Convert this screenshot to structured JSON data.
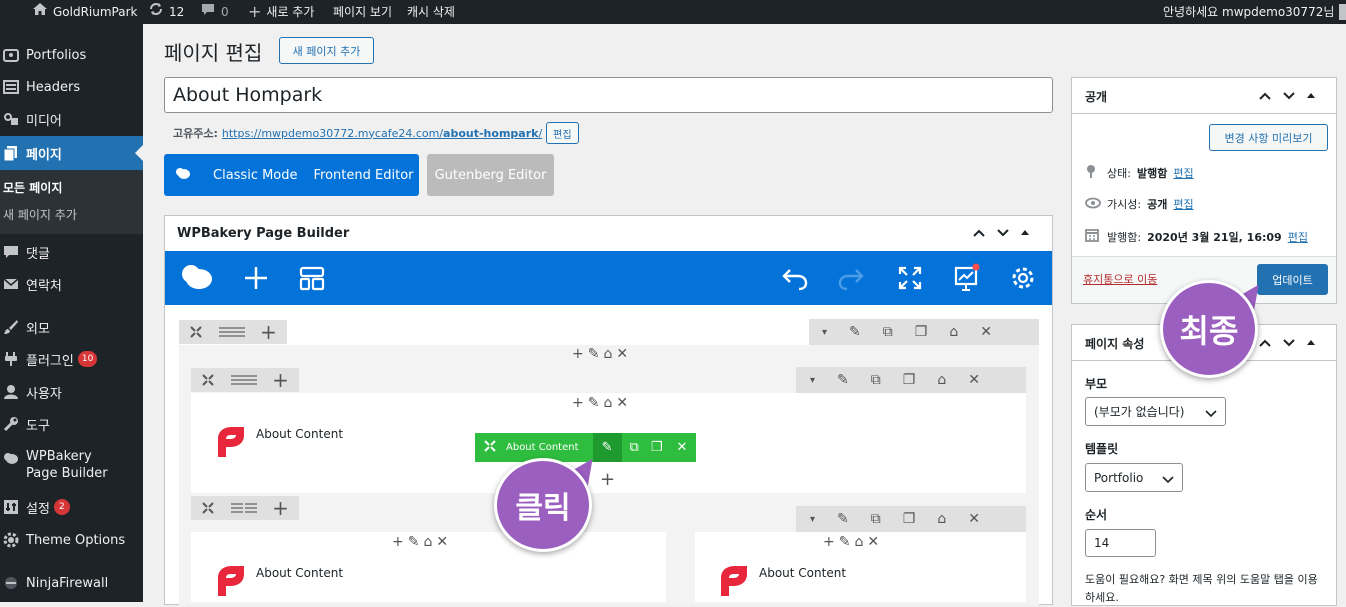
{
  "adminbar": {
    "site": "GoldRiumPark",
    "updates": "12",
    "comments": "0",
    "new": "새로 추가",
    "view": "페이지 보기",
    "cache": "캐시 삭제",
    "greeting": "안녕하세요 mwpdemo30772님"
  },
  "sidebar": {
    "items": [
      {
        "label": "Portfolios",
        "icon": "portfolio-icon"
      },
      {
        "label": "Headers",
        "icon": "header-icon"
      },
      {
        "label": "미디어",
        "icon": "media-icon"
      },
      {
        "label": "페이지",
        "icon": "page-icon"
      },
      {
        "label": "모든 페이지"
      },
      {
        "label": "새 페이지 추가"
      },
      {
        "label": "댓글",
        "icon": "comment-icon"
      },
      {
        "label": "연락처",
        "icon": "mail-icon"
      },
      {
        "label": "외모",
        "icon": "brush-icon"
      },
      {
        "label": "플러그인",
        "icon": "plugin-icon",
        "badge": "10"
      },
      {
        "label": "사용자",
        "icon": "user-icon"
      },
      {
        "label": "도구",
        "icon": "wrench-icon"
      },
      {
        "label": "WPBakery Page Builder",
        "icon": "wpbakery-icon"
      },
      {
        "label": "설정",
        "icon": "settings-icon",
        "badge": "2"
      },
      {
        "label": "Theme Options",
        "icon": "gear-icon"
      },
      {
        "label": "NinjaFirewall",
        "icon": "ninja-icon"
      }
    ]
  },
  "page": {
    "heading": "페이지 편집",
    "add_new": "새 페이지 추가",
    "title_value": "About Hompark",
    "permalink_label": "고유주소:",
    "permalink_base": "https://mwpdemo30772.mycafe24.com/",
    "permalink_slug": "about-hompark",
    "permalink_end": "/",
    "permalink_edit": "편집"
  },
  "editor_buttons": {
    "classic": "Classic Mode",
    "frontend": "Frontend Editor",
    "gutenberg": "Gutenberg Editor"
  },
  "wpb": {
    "title": "WPBakery Page Builder",
    "element_label": "About Content",
    "element_toolbar_label": "About Content"
  },
  "publish": {
    "title": "공개",
    "preview": "변경 사항 미리보기",
    "status_label": "상태:",
    "status_value": "발행함",
    "visibility_label": "가시성:",
    "visibility_value": "공개",
    "published_label": "발행함:",
    "published_value": "2020년 3월 21일, 16:09",
    "edit": "편집",
    "trash": "휴지통으로 이동",
    "update": "업데이트"
  },
  "attributes": {
    "title": "페이지 속성",
    "parent_label": "부모",
    "parent_value": "(부모가 없습니다)",
    "template_label": "템플릿",
    "template_value": "Portfolio",
    "order_label": "순서",
    "order_value": "14",
    "help": "도움이 필요해요? 화면 제목 위의 도움말 탭을 이용하세요."
  },
  "annotations": {
    "final": "최종",
    "click": "클릭"
  },
  "colors": {
    "wp_blue": "#2271b1",
    "wpb_blue": "#0473d9",
    "green": "#2ebd3e",
    "purple": "#9b5fc0",
    "logo_red": "#e8263c"
  }
}
